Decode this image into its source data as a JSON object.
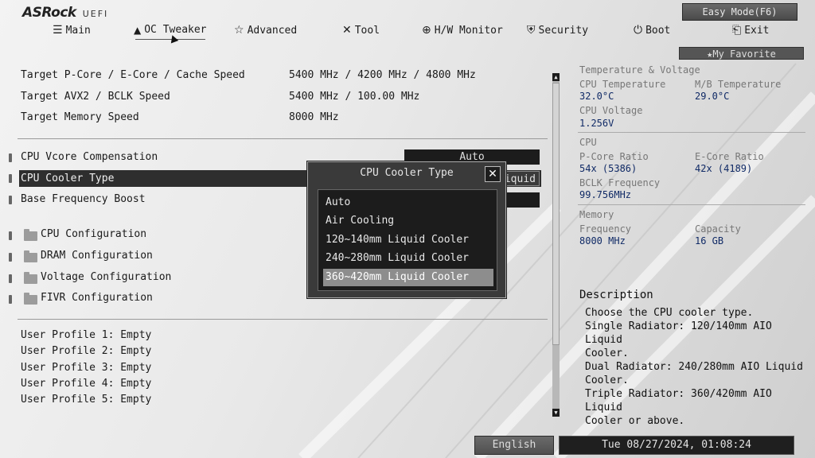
{
  "brand": {
    "logo": "ASRock",
    "sub": "UEFI"
  },
  "easy_mode_label": "Easy Mode(F6)",
  "favorite_label": "My Favorite",
  "nav": [
    {
      "icon": "list-icon",
      "glyph": "☰",
      "label": "Main"
    },
    {
      "icon": "rocket-icon",
      "glyph": "🚀",
      "label": "OC Tweaker",
      "active": true
    },
    {
      "icon": "star-icon",
      "glyph": "☆",
      "label": "Advanced"
    },
    {
      "icon": "wrench-icon",
      "glyph": "✕",
      "label": "Tool"
    },
    {
      "icon": "monitor-icon",
      "glyph": "⊕",
      "label": "H/W Monitor"
    },
    {
      "icon": "shield-icon",
      "glyph": "⛨",
      "label": "Security"
    },
    {
      "icon": "power-icon",
      "glyph": "⏻",
      "label": "Boot"
    },
    {
      "icon": "exit-icon",
      "glyph": "⎗",
      "label": "Exit"
    }
  ],
  "targets": [
    {
      "label": "Target P-Core / E-Core / Cache Speed",
      "value": "5400 MHz / 4200 MHz / 4800 MHz"
    },
    {
      "label": "Target AVX2 / BCLK Speed",
      "value": "5400 MHz / 100.00 MHz"
    },
    {
      "label": "Target Memory Speed",
      "value": "8000 MHz"
    }
  ],
  "settings": [
    {
      "label": "CPU Vcore Compensation",
      "value": "Auto"
    },
    {
      "label": "CPU Cooler Type",
      "value": "360~420mm Liquid Cooler"
    },
    {
      "label": "Base Frequency Boost",
      "value": ""
    }
  ],
  "submenus": [
    "CPU Configuration",
    "DRAM Configuration",
    "Voltage Configuration",
    "FIVR Configuration"
  ],
  "profiles": [
    "User Profile 1: Empty",
    "User Profile 2: Empty",
    "User Profile 3: Empty",
    "User Profile 4: Empty",
    "User Profile 5: Empty"
  ],
  "popup": {
    "title": "CPU Cooler Type",
    "options": [
      "Auto",
      "Air Cooling",
      "120~140mm Liquid Cooler",
      "240~280mm Liquid Cooler",
      "360~420mm Liquid Cooler"
    ],
    "selected_index": 4
  },
  "info": {
    "temp_header": "Temperature & Voltage",
    "cpu_temp_label": "CPU Temperature",
    "cpu_temp": "32.0°C",
    "mb_temp_label": "M/B Temperature",
    "mb_temp": "29.0°C",
    "cpu_volt_label": "CPU Voltage",
    "cpu_volt": "1.256V",
    "cpu_header": "CPU",
    "pcore_label": "P-Core Ratio",
    "pcore": "54x (5386)",
    "ecore_label": "E-Core Ratio",
    "ecore": "42x (4189)",
    "bclk_label": "BCLK Frequency",
    "bclk": "99.756MHz",
    "mem_header": "Memory",
    "freq_label": "Frequency",
    "freq": "8000 MHz",
    "cap_label": "Capacity",
    "cap": "16 GB"
  },
  "description": {
    "title": "Description",
    "body": "Choose the CPU cooler type.\nSingle Radiator: 120/140mm AIO Liquid\nCooler.\nDual Radiator: 240/280mm AIO Liquid\nCooler.\nTriple Radiator: 360/420mm AIO Liquid\nCooler or above."
  },
  "language": "English",
  "datetime": "Tue 08/27/2024, 01:08:24"
}
